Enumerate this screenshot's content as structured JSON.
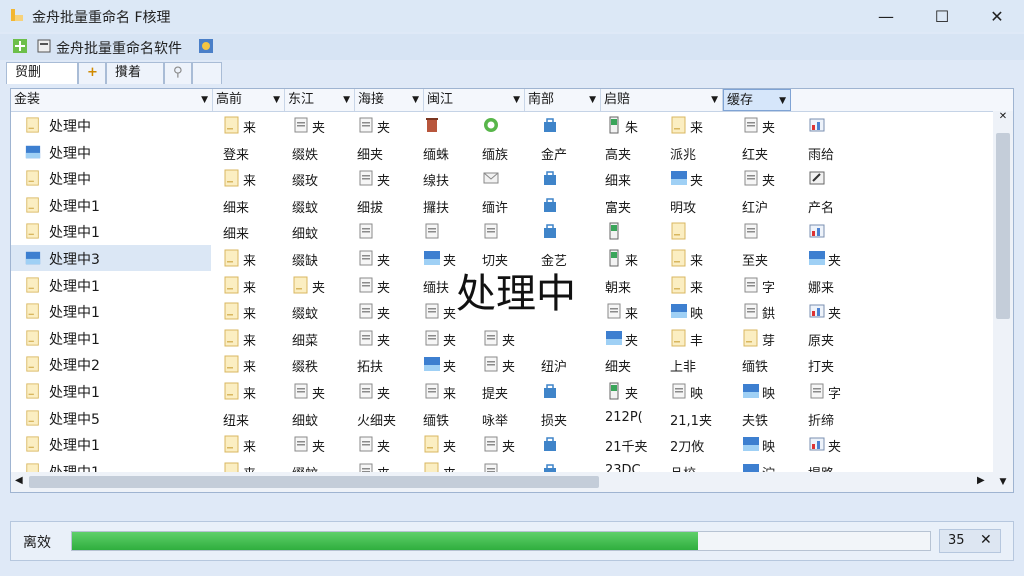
{
  "window": {
    "title": "金舟批量重命名 F核理"
  },
  "toolbar": {
    "label": "金舟批量重命名软件"
  },
  "tabs": [
    "贸删",
    "+",
    "攢着",
    ""
  ],
  "columns": [
    {
      "label": "金装",
      "active": false
    },
    {
      "label": "高前",
      "active": false
    },
    {
      "label": "东江",
      "active": false
    },
    {
      "label": "海接",
      "active": false
    },
    {
      "label": "闽江",
      "active": false
    },
    {
      "label": "南部",
      "active": false
    },
    {
      "label": "启赔",
      "active": false
    },
    {
      "label": "缓存",
      "active": true
    }
  ],
  "tree": [
    {
      "label": "处理中",
      "icon": "folder-icon"
    },
    {
      "label": "处理中",
      "icon": "image-icon"
    },
    {
      "label": "处理中",
      "icon": "folder-icon"
    },
    {
      "label": "处理中1",
      "icon": "folder-icon"
    },
    {
      "label": "处理中1",
      "icon": "folder-icon"
    },
    {
      "label": "处理中3",
      "icon": "image-icon",
      "selected": true
    },
    {
      "label": "处理中1",
      "icon": "folder-icon"
    },
    {
      "label": "处理中1",
      "icon": "folder-icon"
    },
    {
      "label": "处理中1",
      "icon": "folder-icon"
    },
    {
      "label": "处理中2",
      "icon": "folder-icon"
    },
    {
      "label": "处理中1",
      "icon": "folder-icon"
    },
    {
      "label": "处理中5",
      "icon": "folder-icon"
    },
    {
      "label": "处理中1",
      "icon": "folder-icon"
    },
    {
      "label": "处理中1",
      "icon": "folder-icon"
    },
    {
      "label": "处理中1",
      "icon": "folder-icon"
    }
  ],
  "grid": [
    [
      {
        "t": "来",
        "i": "folder-icon"
      },
      {
        "t": "夹",
        "i": "doc-icon"
      },
      {
        "t": "夹",
        "i": "doc-icon"
      },
      {
        "t": "",
        "i": "trash-icon"
      },
      {
        "t": "",
        "i": "refresh-icon"
      },
      {
        "t": "",
        "i": "bag-icon"
      },
      {
        "t": "朱",
        "i": "phone-icon"
      },
      {
        "t": "来",
        "i": "folder-icon"
      },
      {
        "t": "夹",
        "i": "doc-icon"
      },
      {
        "t": "",
        "i": "chart-icon"
      }
    ],
    [
      {
        "t": "登来"
      },
      {
        "t": "缀妷"
      },
      {
        "t": "细夹"
      },
      {
        "t": "缅蛛"
      },
      {
        "t": "缅族"
      },
      {
        "t": "金产"
      },
      {
        "t": "高夹"
      },
      {
        "t": "派兆"
      },
      {
        "t": "红夹"
      },
      {
        "t": "雨给"
      }
    ],
    [
      {
        "t": "来",
        "i": "folder-icon"
      },
      {
        "t": "缀玫",
        "i": "none"
      },
      {
        "t": "夹",
        "i": "doc-icon"
      },
      {
        "t": "缐扶",
        "i": "none"
      },
      {
        "t": "",
        "i": "mail-icon"
      },
      {
        "t": "",
        "i": "bag-icon"
      },
      {
        "t": "细来"
      },
      {
        "t": "夹",
        "i": "image-icon"
      },
      {
        "t": "夹",
        "i": "doc-icon"
      },
      {
        "t": "",
        "i": "edit-icon"
      }
    ],
    [
      {
        "t": "细来"
      },
      {
        "t": "缀蚊"
      },
      {
        "t": "细拔"
      },
      {
        "t": "攞扶"
      },
      {
        "t": "缅许"
      },
      {
        "t": "",
        "i": "bag-icon"
      },
      {
        "t": "富夹"
      },
      {
        "t": "明攻"
      },
      {
        "t": "红沪"
      },
      {
        "t": "产名"
      }
    ],
    [
      {
        "t": "细来"
      },
      {
        "t": "细蚊"
      },
      {
        "t": "",
        "i": "doc-icon"
      },
      {
        "t": "",
        "i": "doc-icon"
      },
      {
        "t": "",
        "i": "doc-icon"
      },
      {
        "t": "",
        "i": "bag-icon"
      },
      {
        "t": "",
        "i": "phone-icon"
      },
      {
        "t": "",
        "i": "folder-icon"
      },
      {
        "t": "",
        "i": "doc-icon"
      },
      {
        "t": "",
        "i": "chart-icon"
      }
    ],
    [
      {
        "t": "来",
        "i": "folder-icon"
      },
      {
        "t": "缀缺"
      },
      {
        "t": "夹",
        "i": "doc-icon"
      },
      {
        "t": "夹",
        "i": "image-icon"
      },
      {
        "t": "切夹"
      },
      {
        "t": "金艺"
      },
      {
        "t": "来",
        "i": "phone-icon"
      },
      {
        "t": "来",
        "i": "folder-icon"
      },
      {
        "t": "至夹"
      },
      {
        "t": "夹",
        "i": "image-icon"
      }
    ],
    [
      {
        "t": "来",
        "i": "folder-icon"
      },
      {
        "t": "夹",
        "i": "folder-icon"
      },
      {
        "t": "夹",
        "i": "doc-icon"
      },
      {
        "t": "缅扶"
      },
      {
        "t": "",
        "i": "none"
      },
      {
        "t": "",
        "i": "none"
      },
      {
        "t": "朝来"
      },
      {
        "t": "来",
        "i": "folder-icon"
      },
      {
        "t": "字",
        "i": "doc-icon"
      },
      {
        "t": "娜来"
      }
    ],
    [
      {
        "t": "来",
        "i": "folder-icon"
      },
      {
        "t": "缀蚊"
      },
      {
        "t": "夹",
        "i": "doc-icon"
      },
      {
        "t": "夹",
        "i": "doc-icon"
      },
      {
        "t": "",
        "i": "none"
      },
      {
        "t": "",
        "i": "none"
      },
      {
        "t": "来",
        "i": "doc-icon"
      },
      {
        "t": "映",
        "i": "image-icon"
      },
      {
        "t": "鉷",
        "i": "doc-icon"
      },
      {
        "t": "夹",
        "i": "chart-icon"
      }
    ],
    [
      {
        "t": "来",
        "i": "folder-icon"
      },
      {
        "t": "细菜"
      },
      {
        "t": "夹",
        "i": "doc-icon"
      },
      {
        "t": "夹",
        "i": "doc-icon"
      },
      {
        "t": "夹",
        "i": "doc-icon"
      },
      {
        "t": "",
        "i": "none"
      },
      {
        "t": "夹",
        "i": "image-icon"
      },
      {
        "t": "丰",
        "i": "folder-icon"
      },
      {
        "t": "芽",
        "i": "folder-icon"
      },
      {
        "t": "原夹"
      }
    ],
    [
      {
        "t": "来",
        "i": "folder-icon"
      },
      {
        "t": "缀秩"
      },
      {
        "t": "拓扶"
      },
      {
        "t": "夹",
        "i": "image-icon"
      },
      {
        "t": "夹",
        "i": "doc-icon"
      },
      {
        "t": "纽沪"
      },
      {
        "t": "细夹"
      },
      {
        "t": "上非"
      },
      {
        "t": "缅铁"
      },
      {
        "t": "打夹"
      }
    ],
    [
      {
        "t": "来",
        "i": "folder-icon"
      },
      {
        "t": "夹",
        "i": "doc-icon"
      },
      {
        "t": "夹",
        "i": "doc-icon"
      },
      {
        "t": "来",
        "i": "doc-icon"
      },
      {
        "t": "提夹"
      },
      {
        "t": "",
        "i": "bag-icon"
      },
      {
        "t": "夹",
        "i": "phone-icon"
      },
      {
        "t": "映",
        "i": "doc-icon"
      },
      {
        "t": "映",
        "i": "image-icon"
      },
      {
        "t": "字",
        "i": "doc-icon"
      }
    ],
    [
      {
        "t": "纽来"
      },
      {
        "t": "细蚊"
      },
      {
        "t": "火细夹"
      },
      {
        "t": "缅铁"
      },
      {
        "t": "咏举"
      },
      {
        "t": "损夹"
      },
      {
        "t": "212P("
      },
      {
        "t": "21,1夹"
      },
      {
        "t": "夫铁"
      },
      {
        "t": "折缔"
      }
    ],
    [
      {
        "t": "来",
        "i": "folder-icon"
      },
      {
        "t": "夹",
        "i": "doc-icon"
      },
      {
        "t": "夹",
        "i": "doc-icon"
      },
      {
        "t": "夹",
        "i": "folder-icon"
      },
      {
        "t": "夹",
        "i": "doc-icon"
      },
      {
        "t": "",
        "i": "bag-icon"
      },
      {
        "t": "21千夹"
      },
      {
        "t": "2刀攸"
      },
      {
        "t": "映",
        "i": "image-icon"
      },
      {
        "t": "夹",
        "i": "chart-icon"
      }
    ],
    [
      {
        "t": "来",
        "i": "folder-icon"
      },
      {
        "t": "缀蚊"
      },
      {
        "t": "夹",
        "i": "doc-icon"
      },
      {
        "t": "夹",
        "i": "folder-icon"
      },
      {
        "t": "",
        "i": "doc-icon"
      },
      {
        "t": "",
        "i": "bag-icon"
      },
      {
        "t": "23DC"
      },
      {
        "t": "品校"
      },
      {
        "t": "泞",
        "i": "image-icon"
      },
      {
        "t": "塌路"
      }
    ],
    [
      {
        "t": "来",
        "i": "folder-icon"
      },
      {
        "t": "猿",
        "i": "doc-icon"
      },
      {
        "t": "鸡",
        "i": "doc-icon"
      },
      {
        "t": "夹",
        "i": "folder-icon"
      },
      {
        "t": "",
        "i": "doc-icon"
      },
      {
        "t": "",
        "i": "bag-icon"
      },
      {
        "t": "DD"
      },
      {
        "t": "印地"
      },
      {
        "t": "浡",
        "i": "image-icon"
      },
      {
        "t": "小茶"
      }
    ]
  ],
  "overlay_text": "处理中",
  "status": {
    "label": "离效",
    "progress": 0.73,
    "badge": "35"
  }
}
